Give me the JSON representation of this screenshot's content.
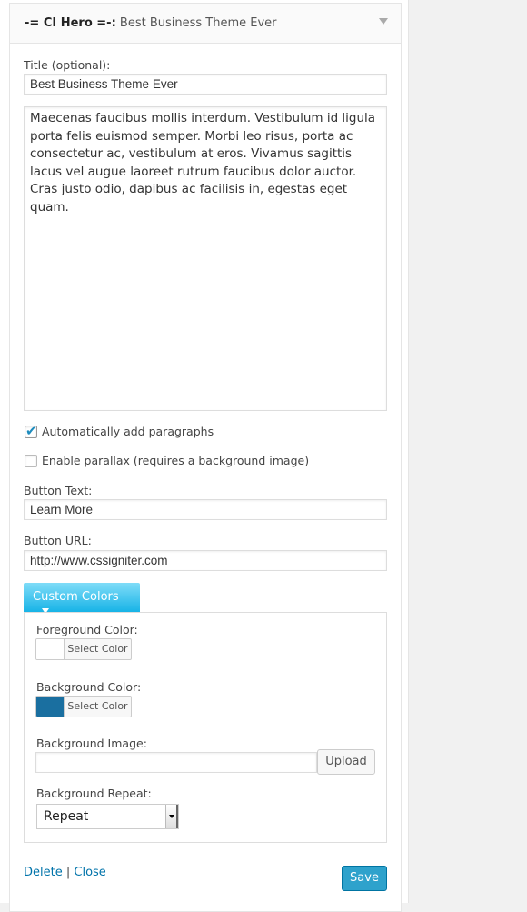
{
  "widget": {
    "name": "-= CI Hero =-:",
    "title": "Best Business Theme Ever"
  },
  "form": {
    "title_label": "Title (optional):",
    "title_value": "Best Business Theme Ever",
    "text_value": "Maecenas faucibus mollis interdum. Vestibulum id ligula porta felis euismod semper. Morbi leo risus, porta ac consectetur ac, vestibulum at eros. Vivamus sagittis lacus vel augue laoreet rutrum faucibus dolor auctor. Cras justo odio, dapibus ac facilisis in, egestas eget quam.",
    "autop_label": "Automatically add paragraphs",
    "autop_checked": true,
    "parallax_label": "Enable parallax (requires a background image)",
    "parallax_checked": false,
    "button_text_label": "Button Text:",
    "button_text_value": "Learn More",
    "button_url_label": "Button URL:",
    "button_url_value": "http://www.cssigniter.com"
  },
  "colors": {
    "tab_label": "Custom Colors",
    "fg_label": "Foreground Color:",
    "fg_color": "#ffffff",
    "bg_label": "Background Color:",
    "bg_color": "#1a6fa0",
    "select_color": "Select Color",
    "bg_image_label": "Background Image:",
    "bg_image_value": "",
    "upload": "Upload",
    "bg_repeat_label": "Background Repeat:",
    "bg_repeat_value": "Repeat"
  },
  "footer": {
    "delete": "Delete",
    "sep": "|",
    "close": "Close",
    "save": "Save"
  }
}
